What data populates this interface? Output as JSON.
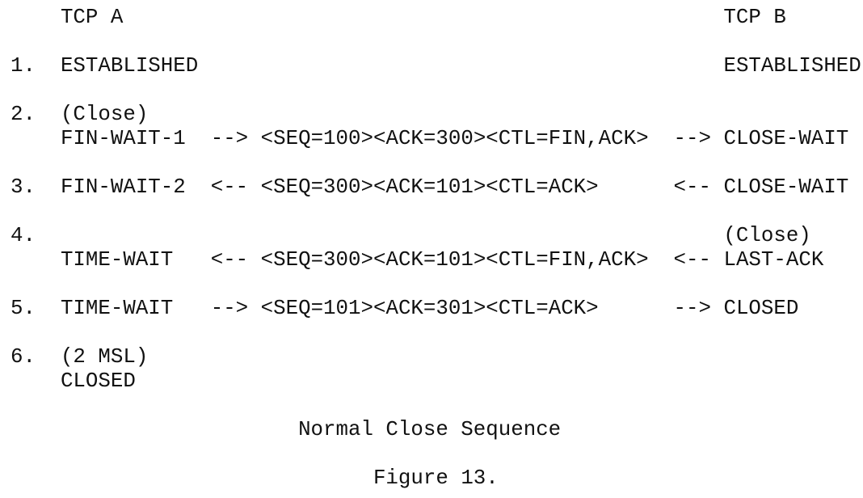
{
  "figure": {
    "header": {
      "left": "TCP A",
      "right": "TCP B"
    },
    "rows": [
      {
        "num": "1.",
        "pre": "",
        "left": "ESTABLISHED",
        "arrow_l": "",
        "segment": "",
        "arrow_r": "",
        "right": "ESTABLISHED",
        "right_pre": ""
      },
      {
        "num": "2.",
        "pre": "(Close)",
        "left": "FIN-WAIT-1",
        "arrow_l": "-->",
        "segment": "<SEQ=100><ACK=300><CTL=FIN,ACK>",
        "arrow_r": "-->",
        "right": "CLOSE-WAIT",
        "right_pre": ""
      },
      {
        "num": "3.",
        "pre": "",
        "left": "FIN-WAIT-2",
        "arrow_l": "<--",
        "segment": "<SEQ=300><ACK=101><CTL=ACK>",
        "arrow_r": "<--",
        "right": "CLOSE-WAIT",
        "right_pre": ""
      },
      {
        "num": "4.",
        "pre": "",
        "left": "TIME-WAIT",
        "arrow_l": "<--",
        "segment": "<SEQ=300><ACK=101><CTL=FIN,ACK>",
        "arrow_r": "<--",
        "right": "LAST-ACK",
        "right_pre": "(Close)"
      },
      {
        "num": "5.",
        "pre": "",
        "left": "TIME-WAIT",
        "arrow_l": "-->",
        "segment": "<SEQ=101><ACK=301><CTL=ACK>",
        "arrow_r": "-->",
        "right": "CLOSED",
        "right_pre": ""
      },
      {
        "num": "6.",
        "pre": "(2 MSL)",
        "left": "CLOSED",
        "arrow_l": "",
        "segment": "",
        "arrow_r": "",
        "right": "",
        "right_pre": ""
      }
    ],
    "caption": "Normal Close Sequence",
    "figure_label": "Figure 13."
  }
}
